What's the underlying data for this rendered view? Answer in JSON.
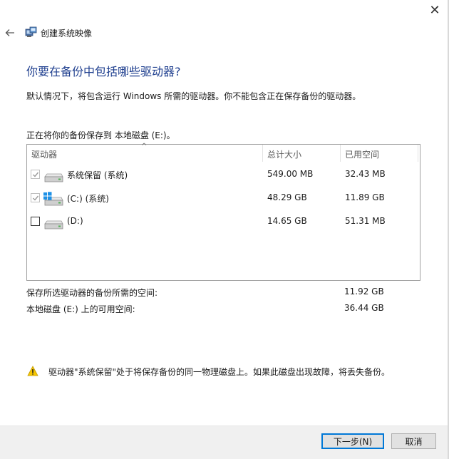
{
  "window": {
    "title": "创建系统映像",
    "close_glyph": "✕"
  },
  "page": {
    "heading": "你要在备份中包括哪些驱动器?",
    "description": "默认情况下，将包含运行 Windows 所需的驱动器。你不能包含正在保存备份的驱动器。",
    "target_label": "正在将你的备份保存到 本地磁盘 (E:)。"
  },
  "list": {
    "columns": {
      "drive": "驱动器",
      "total": "总计大小",
      "used": "已用空间"
    },
    "sort_caret": "^",
    "rows": [
      {
        "label": "系统保留 (系统)",
        "total": "549.00 MB",
        "used": "32.43 MB",
        "checked": true,
        "disabled": true,
        "icon": "drive-icon"
      },
      {
        "label": "(C:) (系统)",
        "total": "48.29 GB",
        "used": "11.89 GB",
        "checked": true,
        "disabled": true,
        "icon": "windows-drive-icon"
      },
      {
        "label": "(D:)",
        "total": "14.65 GB",
        "used": "51.31 MB",
        "checked": false,
        "disabled": false,
        "icon": "drive-icon"
      }
    ]
  },
  "summary": {
    "required_label": "保存所选驱动器的备份所需的空间:",
    "required_value": "11.92 GB",
    "available_label": "本地磁盘 (E:) 上的可用空间:",
    "available_value": "36.44 GB"
  },
  "warning": {
    "icon": "warning-icon",
    "text": "驱动器\"系统保留\"处于将保存备份的同一物理磁盘上。如果此磁盘出现故障，将丢失备份。"
  },
  "buttons": {
    "next": "下一步(N)",
    "cancel": "取消"
  },
  "colors": {
    "heading": "#1f3f8f",
    "primary_border": "#0078d7",
    "footer_bg": "#f0f0f0"
  }
}
